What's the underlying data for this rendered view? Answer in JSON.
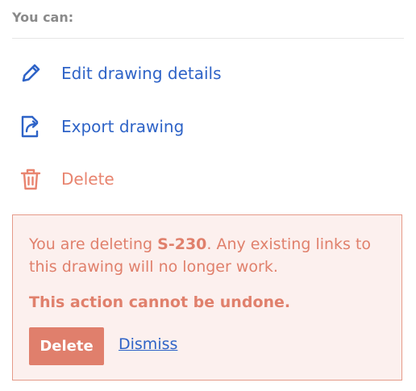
{
  "section": {
    "heading": "You can:"
  },
  "actions": [
    {
      "icon": "pencil-icon",
      "label": "Edit drawing details"
    },
    {
      "icon": "export-icon",
      "label": "Export drawing"
    },
    {
      "icon": "trash-icon",
      "label": "Delete"
    }
  ],
  "warning": {
    "prefix": "You are deleting ",
    "drawing_id": "S-230",
    "suffix": ". Any existing links to this drawing will no longer work.",
    "emphasis": "This action cannot be undone.",
    "delete_label": "Delete",
    "dismiss_label": "Dismiss"
  },
  "colors": {
    "link_blue": "#2e63c7",
    "danger": "#e0806c",
    "danger_bg": "#fcf0ee",
    "heading_gray": "#8a8a8a"
  }
}
